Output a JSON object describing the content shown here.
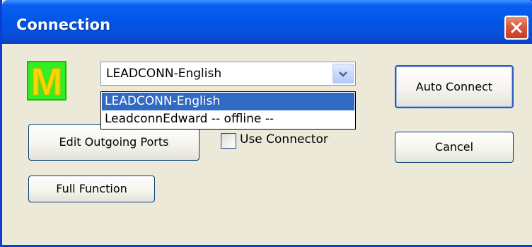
{
  "window": {
    "title": "Connection",
    "close_icon": "close-icon"
  },
  "logo": {
    "letter": "M",
    "icon": "app-logo",
    "color": "#33ee22",
    "letter_color": "#f5d800"
  },
  "combo": {
    "selected_value": "LEADCONN-English",
    "arrow_icon": "chevron-down-icon",
    "options": [
      {
        "label": "LEADCONN-English",
        "selected": true
      },
      {
        "label": "LeadconnEdward -- offline --",
        "selected": false
      }
    ]
  },
  "buttons": {
    "edit_outgoing_ports": "Edit Outgoing Ports",
    "full_function": "Full Function",
    "auto_connect": "Auto Connect",
    "cancel": "Cancel"
  },
  "use_connector": {
    "label": "Use Connector",
    "checked": false
  },
  "colors": {
    "titlebar": "#0055e5",
    "dialog_bg": "#ece9d8",
    "selection": "#316ac5",
    "close_button": "#d9593a"
  }
}
